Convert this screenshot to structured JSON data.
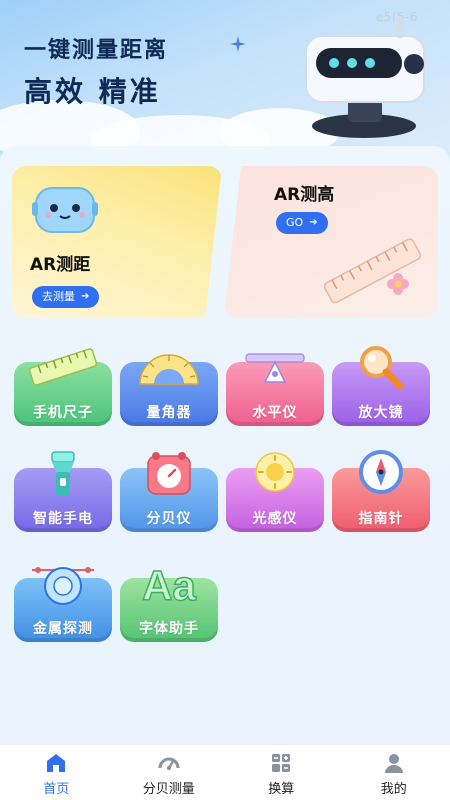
{
  "banner": {
    "code": "e5(5-6",
    "headline": "一键测量距离",
    "subheadline": "高效 精准"
  },
  "ar_cards": {
    "distance": {
      "title": "AR测距",
      "button": "去测量"
    },
    "height": {
      "title": "AR测高",
      "button": "GO"
    }
  },
  "tools": [
    {
      "label": "手机尺子",
      "icon": "ruler-icon",
      "color": "#4cc37a"
    },
    {
      "label": "量角器",
      "icon": "protractor-icon",
      "color": "#4a78e6"
    },
    {
      "label": "水平仪",
      "icon": "level-icon",
      "color": "#ef5f8e"
    },
    {
      "label": "放大镜",
      "icon": "magnifier-icon",
      "color": "#9b5ee8"
    },
    {
      "label": "智能手电",
      "icon": "flashlight-icon",
      "color": "#7469e6"
    },
    {
      "label": "分贝仪",
      "icon": "decibel-meter-icon",
      "color": "#4f94ea"
    },
    {
      "label": "光感仪",
      "icon": "light-sensor-icon",
      "color": "#c45fdf"
    },
    {
      "label": "指南针",
      "icon": "compass-icon",
      "color": "#ee5c6f"
    },
    {
      "label": "金属探测",
      "icon": "metal-detector-icon",
      "color": "#3f8fe6"
    },
    {
      "label": "字体助手",
      "icon": "font-icon",
      "color": "#52c372"
    }
  ],
  "nav": {
    "items": [
      {
        "label": "首页",
        "icon": "home-icon",
        "active": true
      },
      {
        "label": "分贝测量",
        "icon": "gauge-icon",
        "active": false
      },
      {
        "label": "换算",
        "icon": "calculator-icon",
        "active": false
      },
      {
        "label": "我的",
        "icon": "profile-icon",
        "active": false
      }
    ],
    "active_color": "#2f6ff0"
  }
}
